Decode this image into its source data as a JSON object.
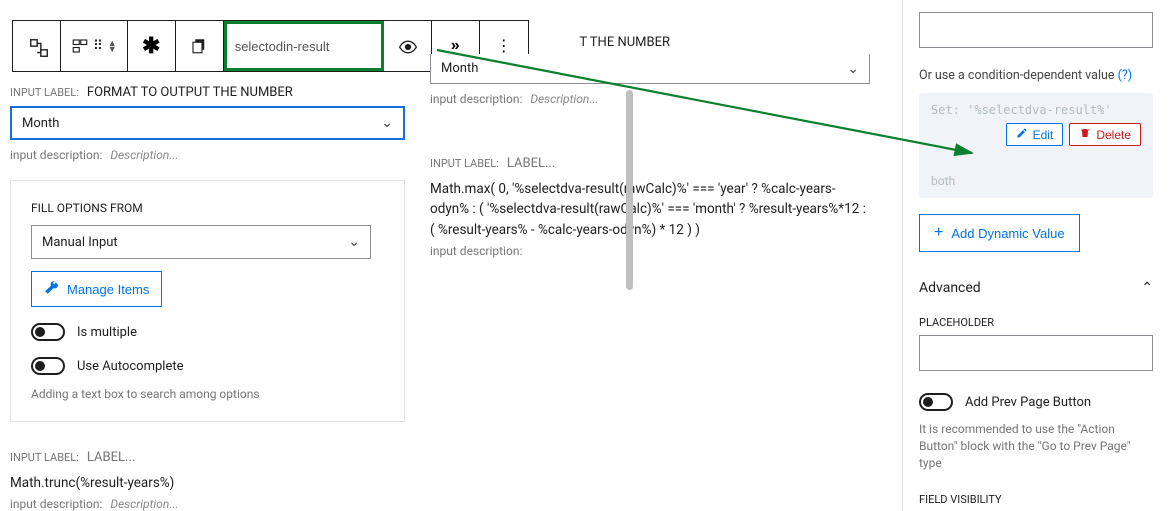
{
  "toolbar": {
    "name_input_value": "selectodin-result"
  },
  "col1": {
    "input_label_caption": "INPUT LABEL:",
    "input_label_value": "FORMAT TO OUTPUT THE NUMBER",
    "select_value": "Month",
    "desc_caption": "input description:",
    "desc_placeholder": "Description...",
    "fill_options_heading": "FILL OPTIONS FROM",
    "fill_options_value": "Manual Input",
    "manage_items_label": "Manage Items",
    "toggle1_label": "Is multiple",
    "toggle2_label": "Use Autocomplete",
    "autocomplete_help": "Adding a text box to search among options",
    "block2_caption": "INPUT LABEL:",
    "block2_label": "LABEL...",
    "block2_formula": "Math.trunc(%result-years%)",
    "block2_desc_caption": "input description:",
    "block2_desc_placeholder": "Description..."
  },
  "col2": {
    "top_label_fragment": "T THE NUMBER",
    "top_select_value": "Month",
    "top_desc_caption": "input description:",
    "top_desc_placeholder": "Description...",
    "mid_caption": "INPUT LABEL:",
    "mid_label": "LABEL...",
    "mid_formula": "Math.max( 0, '%selectdva-result(rawCalc)%' === 'year' ? %calc-years-odyn% : ( '%selectdva-result(rawCalc)%' === 'month' ? %result-years%*12 : ( %result-years% - %calc-years-odyn%) * 12 ) )",
    "mid_desc_caption": "input description:"
  },
  "sidebar": {
    "cond_text": "Or use a condition-dependent value",
    "cond_help": "(?)",
    "set_text": "Set:  '%selectdva-result%'",
    "both_text": "both",
    "edit_label": "Edit",
    "delete_label": "Delete",
    "add_dynamic_label": "Add Dynamic Value",
    "advanced_label": "Advanced",
    "placeholder_label": "PLACEHOLDER",
    "add_prev_label": "Add Prev Page Button",
    "add_prev_help": "It is recommended to use the \"Action Button\" block with the \"Go to Prev Page\" type",
    "visibility_label": "FIELD VISIBILITY"
  }
}
